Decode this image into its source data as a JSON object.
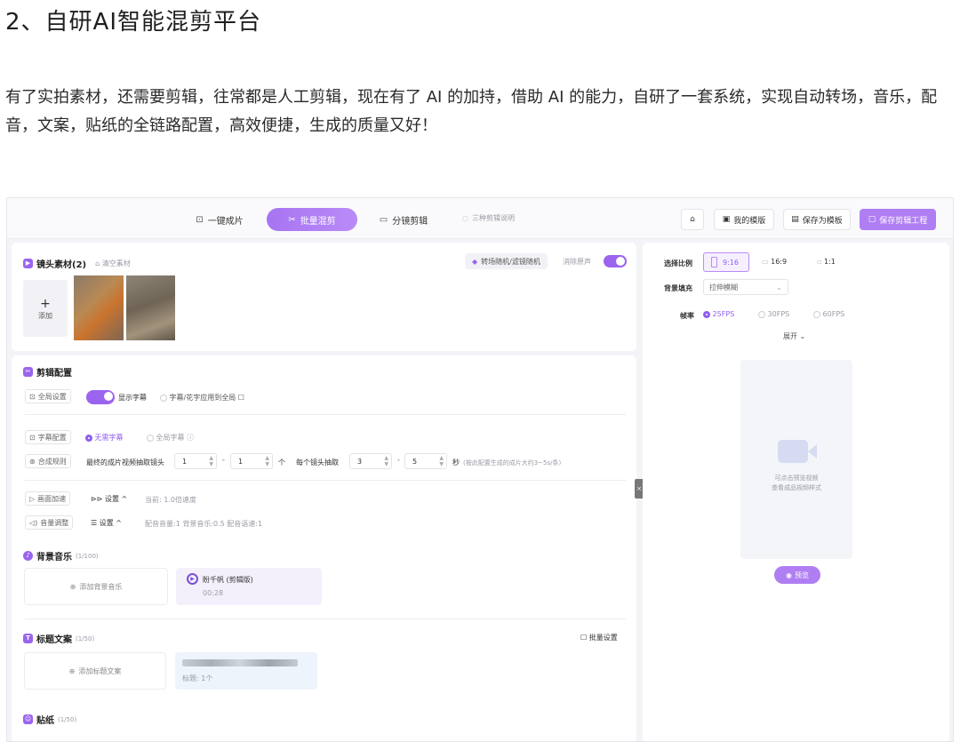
{
  "article": {
    "title": "2、自研AI智能混剪平台",
    "paragraph": "有了实拍素材，还需要剪辑，往常都是人工剪辑，现在有了 AI 的加持，借助 AI 的能力，自研了一套系统，实现自动转场，音乐，配音，文案，贴纸的全链路配置，高效便捷，生成的质量又好！"
  },
  "topbar": {
    "tabs": [
      "一键成片",
      "批量混剪",
      "分镜剪辑"
    ],
    "active_tab": "批量混剪",
    "mode_desc": "三种剪辑说明",
    "home_label": "⌂",
    "my_templates": "我的模版",
    "save_template": "保存为模板",
    "save_project": "保存剪辑工程"
  },
  "materials": {
    "title": "镜头素材(2)",
    "clear": "清空素材",
    "effect_btn": "转场随机/滤镜随机",
    "mute_label": "消除原声",
    "add_label": "添加",
    "add_symbol": "+"
  },
  "edit_config": {
    "title": "剪辑配置",
    "global_chip": "全局设置",
    "show_subtitle": "显示字幕",
    "apply_global": "字幕/花字应用到全局",
    "subtitle_chip": "字幕配置",
    "no_subtitle": "无需字幕",
    "full_subtitle": "全局字幕",
    "synth_chip": "合成规则",
    "synth_text": "最终的成片视频抽取镜头",
    "min1": "1",
    "max1": "1",
    "unit1": "个",
    "per_shot": "每个镜头抽取",
    "min2": "3",
    "max2": "5",
    "unit2": "秒",
    "hint": "(按此配置生成的成片大约3~5s/条)",
    "dash": "-",
    "speed_chip": "画面加速",
    "speed_setting": "设置 ^",
    "speed_value": "当前: 1.0倍速度",
    "volume_chip": "音量调整",
    "volume_setting": "设置 ^",
    "volume_value": "配音音量:1 背景音乐:0.5 配音语速:1"
  },
  "music": {
    "title": "背景音乐",
    "count": "(1/100)",
    "add": "添加背景音乐",
    "track_name": "盼千帆 (剪辑版)",
    "track_time": "00:28"
  },
  "copy": {
    "title": "标题文案",
    "count": "(1/50)",
    "batch": "批量设置",
    "add": "添加标题文案",
    "item_label": "标题: 1个"
  },
  "sticker": {
    "title": "贴纸",
    "count": "(1/50)"
  },
  "right_panel": {
    "ratio_label": "选择比例",
    "ratios": [
      "9:16",
      "16:9",
      "1:1"
    ],
    "bg_label": "背景填充",
    "bg_value": "拉伸模糊",
    "fps_label": "帧率",
    "fps": [
      "25FPS",
      "30FPS",
      "60FPS"
    ],
    "expand": "展开",
    "preview_hint1": "可点击预览视频",
    "preview_hint2": "查看成品视频样式",
    "preview_btn": "预览"
  },
  "colors": {
    "accent": "#9b64ef",
    "accent_light": "#b07ef3"
  }
}
